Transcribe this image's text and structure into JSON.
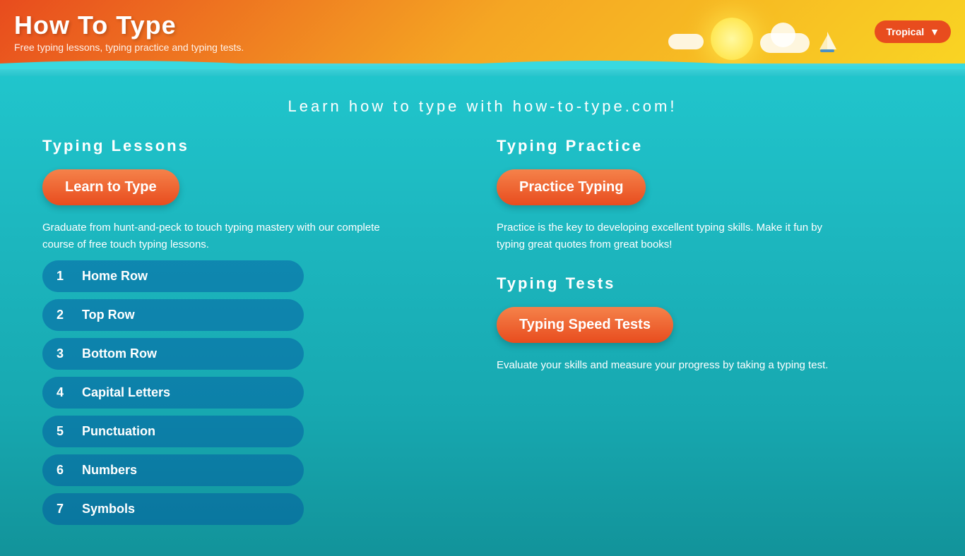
{
  "header": {
    "title": "How To Type",
    "subtitle": "Free typing lessons, typing practice and typing tests.",
    "theme_label": "Tropical"
  },
  "page": {
    "headline": "Learn how to type with how-to-type.com!"
  },
  "lessons_section": {
    "title": "Typing Lessons",
    "button_label": "Learn to Type",
    "description": "Graduate from hunt-and-peck to touch typing mastery with our complete course of free touch typing lessons.",
    "items": [
      {
        "num": "1",
        "name": "Home Row"
      },
      {
        "num": "2",
        "name": "Top Row"
      },
      {
        "num": "3",
        "name": "Bottom Row"
      },
      {
        "num": "4",
        "name": "Capital Letters"
      },
      {
        "num": "5",
        "name": "Punctuation"
      },
      {
        "num": "6",
        "name": "Numbers"
      },
      {
        "num": "7",
        "name": "Symbols"
      }
    ]
  },
  "practice_section": {
    "title": "Typing Practice",
    "button_label": "Practice Typing",
    "description": "Practice is the key to developing excellent typing skills. Make it fun by typing great quotes from great books!"
  },
  "tests_section": {
    "title": "Typing Tests",
    "button_label": "Typing Speed Tests",
    "description": "Evaluate your skills and measure your progress by taking a typing test."
  }
}
